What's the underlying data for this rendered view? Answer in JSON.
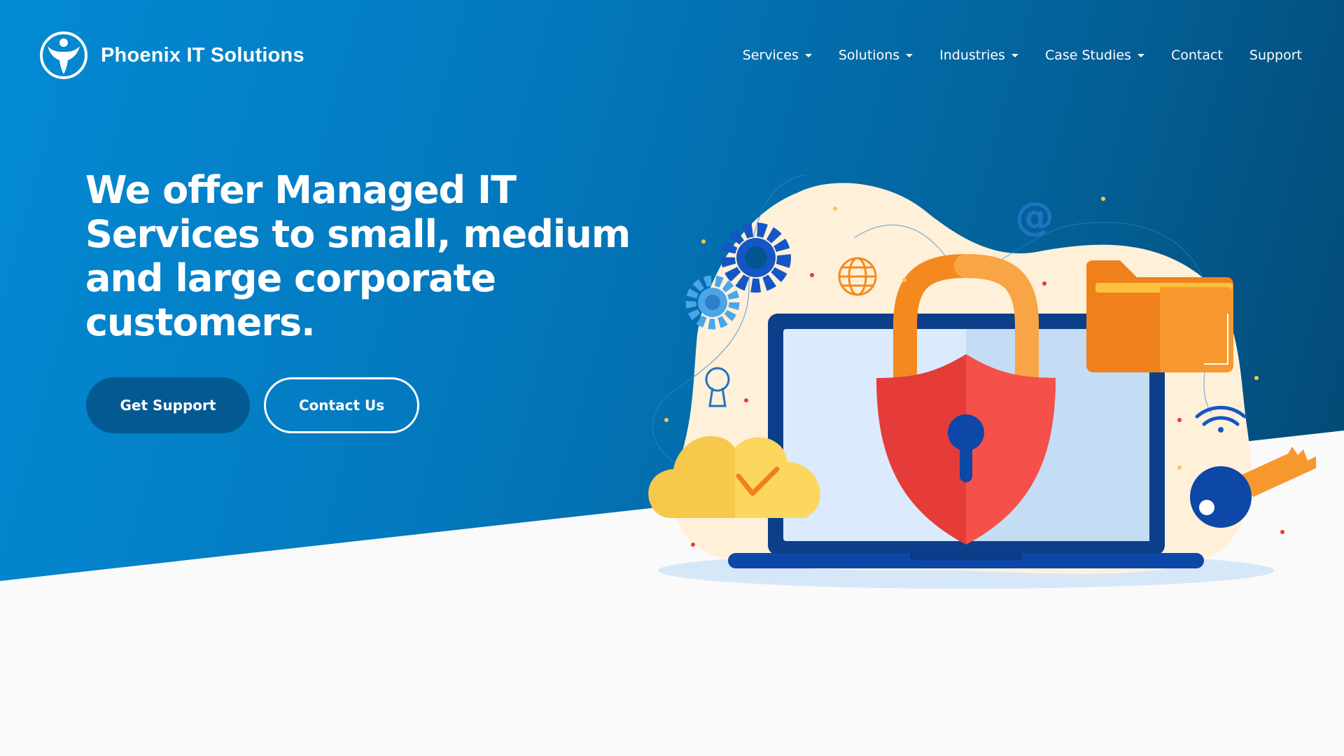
{
  "brand": {
    "name": "Phoenix IT Solutions",
    "logo_icon": "phoenix-logo-icon"
  },
  "nav": {
    "items": [
      {
        "label": "Services",
        "has_dropdown": true
      },
      {
        "label": "Solutions",
        "has_dropdown": true
      },
      {
        "label": "Industries",
        "has_dropdown": true
      },
      {
        "label": "Case Studies",
        "has_dropdown": true
      },
      {
        "label": "Contact",
        "has_dropdown": false
      },
      {
        "label": "Support",
        "has_dropdown": false
      }
    ]
  },
  "hero": {
    "headline": "We offer Managed IT Services to small, medium and large corporate customers.",
    "primary_button": "Get Support",
    "secondary_button": "Contact Us",
    "illustration_icons": [
      "laptop-icon",
      "padlock-shield-icon",
      "folder-icon",
      "cloud-check-icon",
      "gear-icon",
      "globe-icon",
      "at-sign-icon",
      "wifi-icon",
      "key-icon",
      "keyhole-icon"
    ]
  },
  "colors": {
    "gradient_start": "#038ad4",
    "gradient_end": "#03466f",
    "primary_button": "#035a92",
    "background_lower": "#fafafa",
    "accent_orange": "#f48a1f",
    "accent_red": "#ef4340",
    "accent_yellow": "#f7c948"
  }
}
